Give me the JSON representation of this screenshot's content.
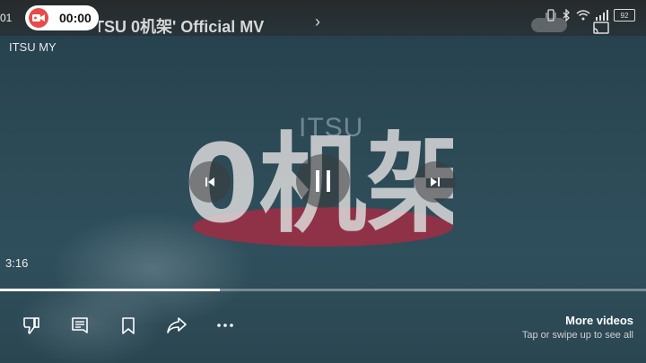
{
  "status_bar": {
    "time_fragment": "01",
    "battery_level": "92"
  },
  "screen_recorder": {
    "elapsed": "00:00",
    "accent_color": "#e84a4a"
  },
  "video": {
    "title": "Stay...ing 'ITSU 0机架' Official MV",
    "channel": "ITSU MY",
    "logo_small_text": "ITSU",
    "logo_big_text": "0机架",
    "elapsed_time": "3:16",
    "progress_fraction": 0.34
  },
  "controls": {
    "previous": "previous-icon",
    "pause": "pause-icon",
    "next": "next-icon"
  },
  "actions": {
    "items": [
      "dislike-icon",
      "comment-icon",
      "save-icon",
      "share-icon",
      "more-icon"
    ]
  },
  "more_videos": {
    "title": "More videos",
    "subtitle": "Tap or swipe up to see all"
  }
}
